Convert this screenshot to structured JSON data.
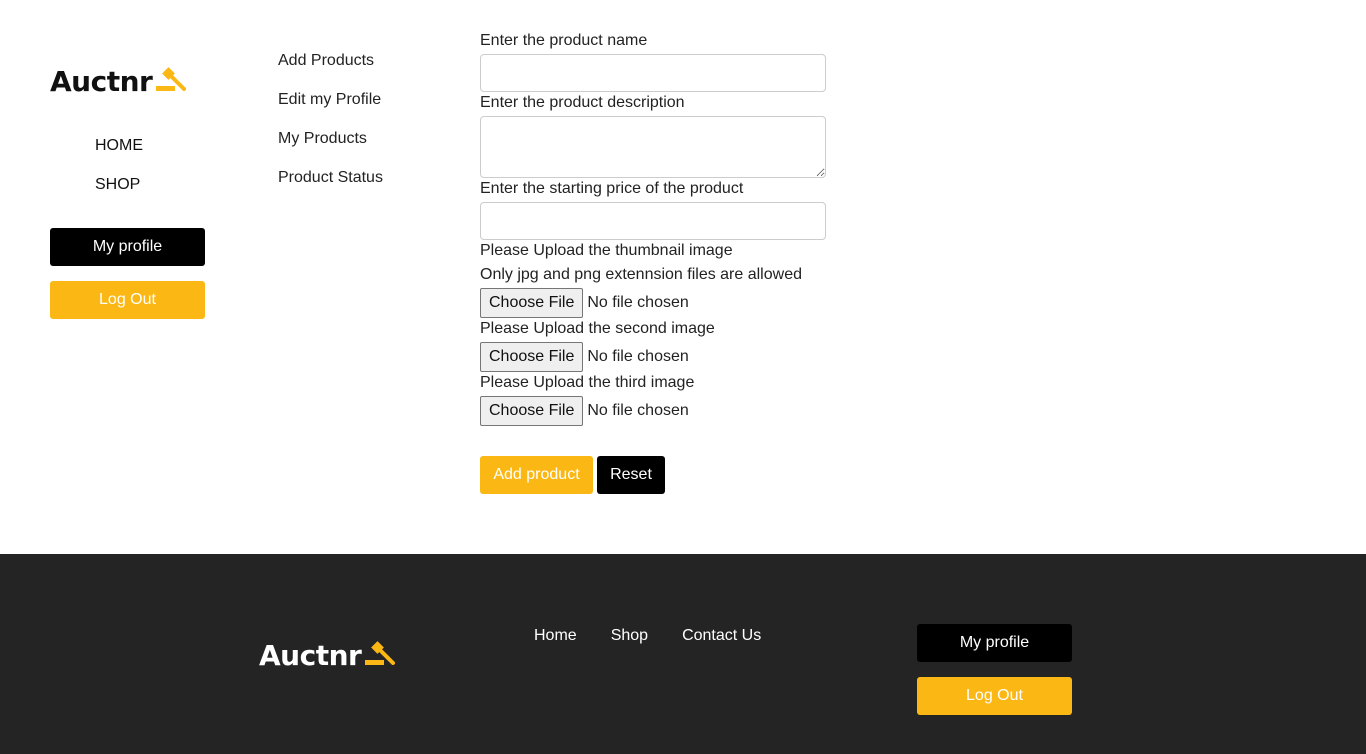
{
  "brand": {
    "name": "Auctnr",
    "accent": "#fbb713"
  },
  "main_nav": [
    {
      "label": "HOME"
    },
    {
      "label": "SHOP"
    }
  ],
  "sidebar": {
    "profile_button": "My profile",
    "logout_button": "Log Out"
  },
  "dashboard_nav": [
    {
      "label": "Add Products"
    },
    {
      "label": "Edit my Profile"
    },
    {
      "label": "My Products"
    },
    {
      "label": "Product Status"
    }
  ],
  "form": {
    "name_label": "Enter the product name",
    "name_value": "",
    "description_label": "Enter the product description",
    "description_value": "",
    "price_label": "Enter the starting price of the product",
    "price_value": "",
    "thumb_label": "Please Upload the thumbnail image",
    "thumb_note": "Only jpg and png extennsion files are allowed",
    "second_label": "Please Upload the second image",
    "third_label": "Please Upload the third image",
    "choose_file": "Choose File",
    "no_file": "No file chosen",
    "submit_label": "Add product",
    "reset_label": "Reset"
  },
  "footer": {
    "nav": [
      {
        "label": "Home"
      },
      {
        "label": "Shop"
      },
      {
        "label": "Contact Us"
      }
    ],
    "profile_button": "My profile",
    "logout_button": "Log Out",
    "background": "#242424"
  }
}
